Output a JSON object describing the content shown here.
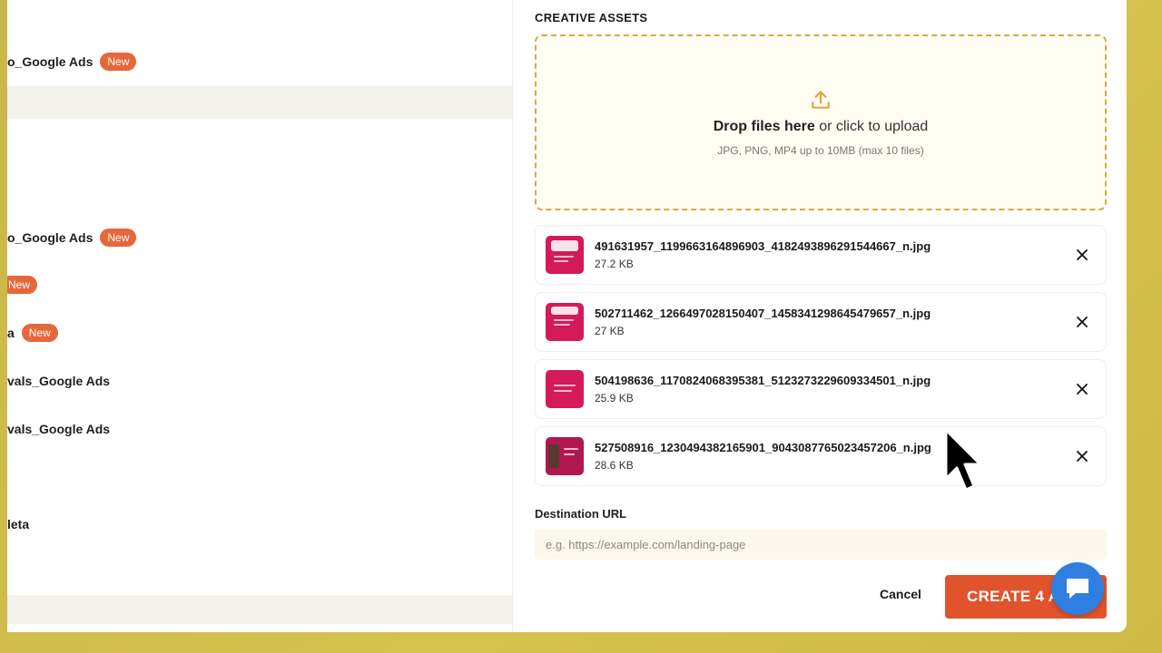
{
  "left_list": {
    "items": [
      {
        "label": "o_Google Ads",
        "badge": "New"
      },
      {
        "label": "o_Google Ads",
        "badge": "New"
      },
      {
        "label": "",
        "badge": "New"
      },
      {
        "label": "a",
        "badge": "New"
      },
      {
        "label": "vals_Google Ads",
        "badge": ""
      },
      {
        "label": "vals_Google Ads",
        "badge": ""
      },
      {
        "label": "leta",
        "badge": ""
      }
    ]
  },
  "modal": {
    "section_title": "CREATIVE ASSETS",
    "dropzone": {
      "main_bold": "Drop files here",
      "main_rest": " or click to upload",
      "hint": "JPG, PNG, MP4 up to 10MB (max 10 files)",
      "icon": "upload-icon",
      "accent_color": "#e0a640"
    },
    "files": [
      {
        "name": "491631957_1199663164896903_4182493896291544667_n.jpg",
        "size": "27.2 KB"
      },
      {
        "name": "502711462_1266497028150407_1458341298645479657_n.jpg",
        "size": "27 KB"
      },
      {
        "name": "504198636_1170824068395381_5123273229609334501_n.jpg",
        "size": "25.9 KB"
      },
      {
        "name": "527508916_1230494382165901_9043087765023457206_n.jpg",
        "size": "28.6 KB"
      }
    ],
    "destination_url": {
      "label": "Destination URL",
      "placeholder": "e.g. https://example.com/landing-page",
      "value": ""
    },
    "cancel_label": "Cancel",
    "create_label": "CREATE 4 ADS",
    "brand_color": "#e0532b"
  }
}
